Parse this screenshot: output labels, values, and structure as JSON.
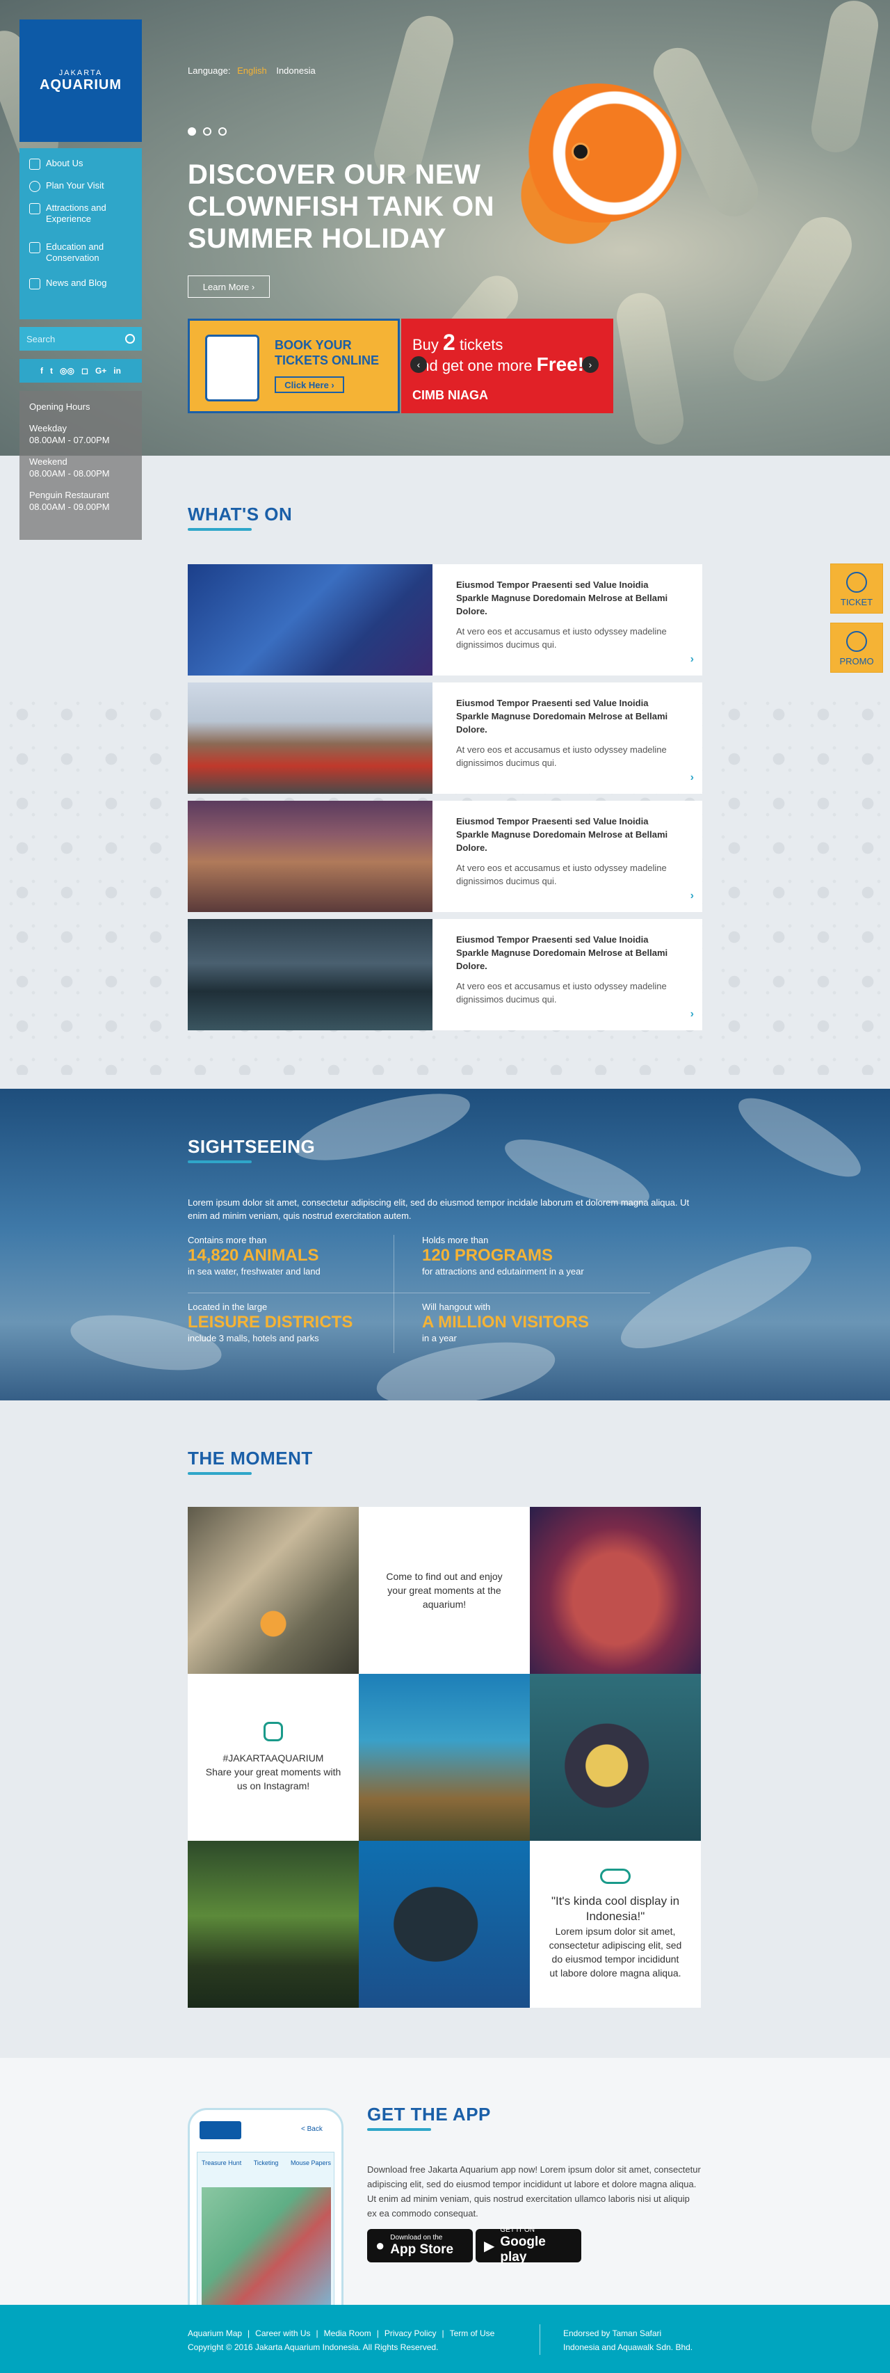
{
  "brand": {
    "line1": "JAKARTA",
    "line2": "AQUARIUM",
    "color": "#0d5aa7"
  },
  "nav": {
    "items": [
      {
        "label": "About Us",
        "icon": "eye-icon"
      },
      {
        "label": "Plan Your Visit",
        "icon": "person-icon"
      },
      {
        "label": "Attractions and Experience",
        "icon": "eye-icon"
      },
      {
        "label": "Education and Conservation",
        "icon": "book-icon"
      },
      {
        "label": "News and Blog",
        "icon": "news-icon"
      }
    ]
  },
  "search": {
    "placeholder": "Search"
  },
  "social": [
    "f",
    "t",
    "tripadvisor",
    "instagram",
    "G+",
    "in"
  ],
  "hours": {
    "title": "Opening Hours",
    "groups": [
      {
        "label": "Weekday",
        "time": "08.00AM - 07.00PM"
      },
      {
        "label": "Weekend",
        "time": "08.00AM - 08.00PM"
      },
      {
        "label": "Penguin Restaurant",
        "time": "08.00AM - 09.00PM"
      }
    ]
  },
  "language": {
    "label": "Language:",
    "current": "English",
    "alternate": "Indonesia"
  },
  "hero": {
    "title": "DISCOVER OUR NEW CLOWNFISH TANK ON SUMMER HOLIDAY",
    "cta": "Learn More",
    "slides": 3,
    "active_slide": 1
  },
  "promo": {
    "book_title": "BOOK YOUR TICKETS ONLINE",
    "book_button": "Click Here",
    "cimb_line1": "Buy",
    "cimb_num": "2",
    "cimb_line1b": "tickets",
    "cimb_line2": "and get one more",
    "cimb_free": "Free!",
    "cimb_bank": "CIMB NIAGA"
  },
  "sidetabs": {
    "ticket": "TICKET",
    "promo": "PROMO"
  },
  "whats_on": {
    "heading": "WHAT'S ON",
    "cards": [
      {
        "title": "Eiusmod Tempor Praesenti sed Value Inoidia Sparkle Magnuse Doredomain Melrose at Bellami Dolore.",
        "desc": "At vero eos et accusamus et iusto odyssey madeline dignissimos ducimus qui."
      },
      {
        "title": "Eiusmod Tempor Praesenti sed Value Inoidia Sparkle Magnuse Doredomain Melrose at Bellami Dolore.",
        "desc": "At vero eos et accusamus et iusto odyssey madeline dignissimos ducimus qui."
      },
      {
        "title": "Eiusmod Tempor Praesenti sed Value Inoidia Sparkle Magnuse Doredomain Melrose at Bellami Dolore.",
        "desc": "At vero eos et accusamus et iusto odyssey madeline dignissimos ducimus qui."
      },
      {
        "title": "Eiusmod Tempor Praesenti sed Value Inoidia Sparkle Magnuse Doredomain Melrose at Bellami Dolore.",
        "desc": "At vero eos et accusamus et iusto odyssey madeline dignissimos ducimus qui."
      }
    ]
  },
  "sightseeing": {
    "heading": "SIGHTSEEING",
    "intro": "Lorem ipsum dolor sit amet, consectetur adipiscing elit, sed do eiusmod tempor incidale laborum et dolorem magna aliqua. Ut enim ad minim veniam, quis nostrud exercitation autem.",
    "stats": [
      {
        "label": "Contains more than",
        "big": "14,820 ANIMALS",
        "sub": "in sea water, freshwater and land"
      },
      {
        "label": "Holds more than",
        "big": "120 PROGRAMS",
        "sub": "for attractions and edutainment in a year"
      },
      {
        "label": "Located in the large",
        "big": "LEISURE DISTRICTS",
        "sub": "include 3 malls, hotels and parks"
      },
      {
        "label": "Will hangout with",
        "big": "A MILLION VISITORS",
        "sub": "in a year"
      }
    ]
  },
  "moment": {
    "heading": "THE MOMENT",
    "intro": "Come to find out and enjoy your great moments at the aquarium!",
    "instagram_tag": "#JAKARTAAQUARIUM",
    "instagram_text": "Share your great moments with us on Instagram!",
    "quote": "\"It's kinda cool display in Indonesia!\"",
    "quote_body": "Lorem ipsum dolor sit amet, consectetur adipiscing elit, sed do eiusmod tempor incididunt ut labore dolore magna aliqua."
  },
  "app": {
    "heading": "GET THE APP",
    "body": "Download free Jakarta Aquarium app now! Lorem ipsum dolor sit amet, consectetur adipiscing elit, sed do eiusmod tempor incididunt ut labore et dolore magna aliqua. Ut enim ad minim veniam, quis nostrud exercitation ullamco laboris nisi ut aliquip ex ea commodo consequat.",
    "appstore_small": "Download on the",
    "appstore_big": "App Store",
    "gplay_small": "GET IT ON",
    "gplay_big": "Google play",
    "phone_back": "< Back",
    "phone_tabs": [
      "Treasure Hunt",
      "Ticketing",
      "Mouse Papers"
    ]
  },
  "footer": {
    "links": [
      "Aquarium Map",
      "Career with Us",
      "Media Room",
      "Privacy Policy",
      "Term of Use"
    ],
    "copyright": "Copyright © 2016 Jakarta Aquarium Indonesia. All Rights Reserved.",
    "endorse1": "Endorsed by Taman Safari",
    "endorse2": "Indonesia and Aquawalk Sdn. Bhd."
  },
  "colors": {
    "accent": "#2fa6c9",
    "brand": "#1a5fa8",
    "yellow": "#f5b335",
    "red": "#e12127",
    "footer": "#00a5bf"
  }
}
